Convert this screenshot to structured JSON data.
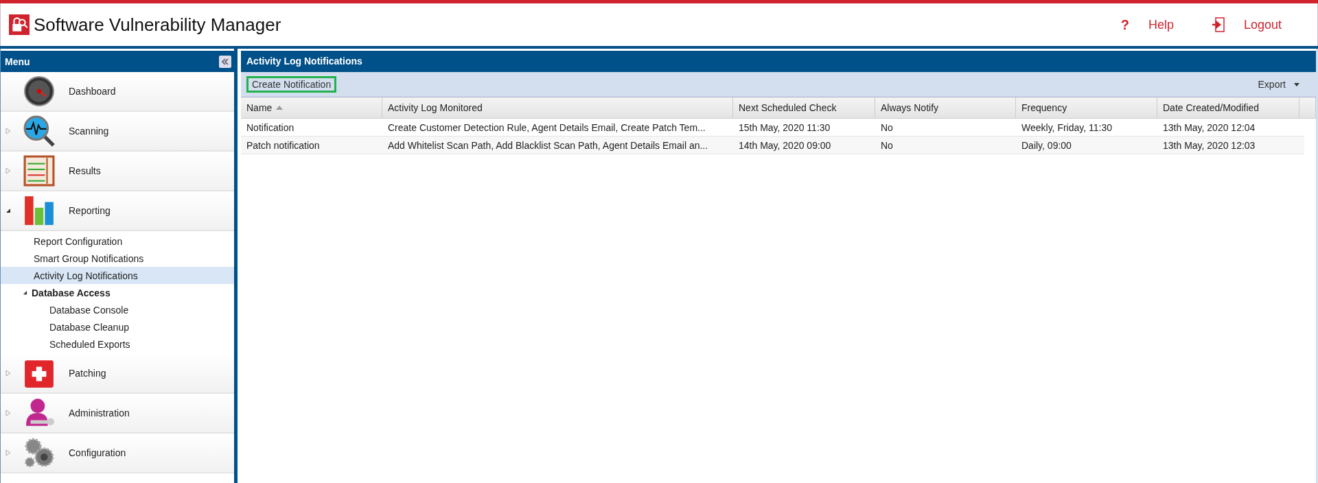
{
  "header": {
    "title": "Software Vulnerability Manager",
    "links": [
      {
        "kind": "help",
        "icon": "?",
        "label": "Help"
      },
      {
        "kind": "logout",
        "label": "Logout"
      }
    ]
  },
  "sidebar": {
    "title": "Menu",
    "items": [
      {
        "label": "Dashboard",
        "kind": "link"
      },
      {
        "label": "Scanning",
        "kind": "group",
        "expanded": false
      },
      {
        "label": "Results",
        "kind": "group",
        "expanded": false
      },
      {
        "label": "Reporting",
        "kind": "group",
        "expanded": true,
        "children": [
          {
            "label": "Report Configuration",
            "selected": false
          },
          {
            "label": "Smart Group Notifications",
            "selected": false
          },
          {
            "label": "Activity Log Notifications",
            "selected": true
          },
          {
            "label": "Database Access",
            "selected": false,
            "expanded": true,
            "children": [
              {
                "label": "Database Console",
                "selected": false
              },
              {
                "label": "Database Cleanup",
                "selected": false
              },
              {
                "label": "Scheduled Exports",
                "selected": false
              }
            ]
          }
        ]
      },
      {
        "label": "Patching",
        "kind": "group",
        "expanded": false
      },
      {
        "label": "Administration",
        "kind": "group",
        "expanded": false
      },
      {
        "label": "Configuration",
        "kind": "group",
        "expanded": false
      }
    ]
  },
  "panel": {
    "title": "Activity Log Notifications",
    "toolbar": {
      "create_button": "Create Notification",
      "export_button": "Export"
    },
    "table": {
      "columns": [
        {
          "label": "Name",
          "sorted": true
        },
        {
          "label": "Activity Log Monitored",
          "sorted": false
        },
        {
          "label": "Next Scheduled Check",
          "sorted": false
        },
        {
          "label": "Always Notify",
          "sorted": false
        },
        {
          "label": "Frequency",
          "sorted": false
        },
        {
          "label": "Date Created/Modified",
          "sorted": false
        }
      ],
      "rows": [
        [
          "Notification",
          "Create Customer Detection Rule, Agent Details Email, Create Patch Tem...",
          "15th May, 2020 11:30",
          "No",
          "Weekly, Friday, 11:30",
          "13th May, 2020 12:04"
        ],
        [
          "Patch notification",
          "Add Whitelist Scan Path, Add Blacklist Scan Path, Agent Details Email an...",
          "14th May, 2020 09:00",
          "No",
          "Daily, 09:00",
          "13th May, 2020 12:03"
        ]
      ]
    }
  }
}
